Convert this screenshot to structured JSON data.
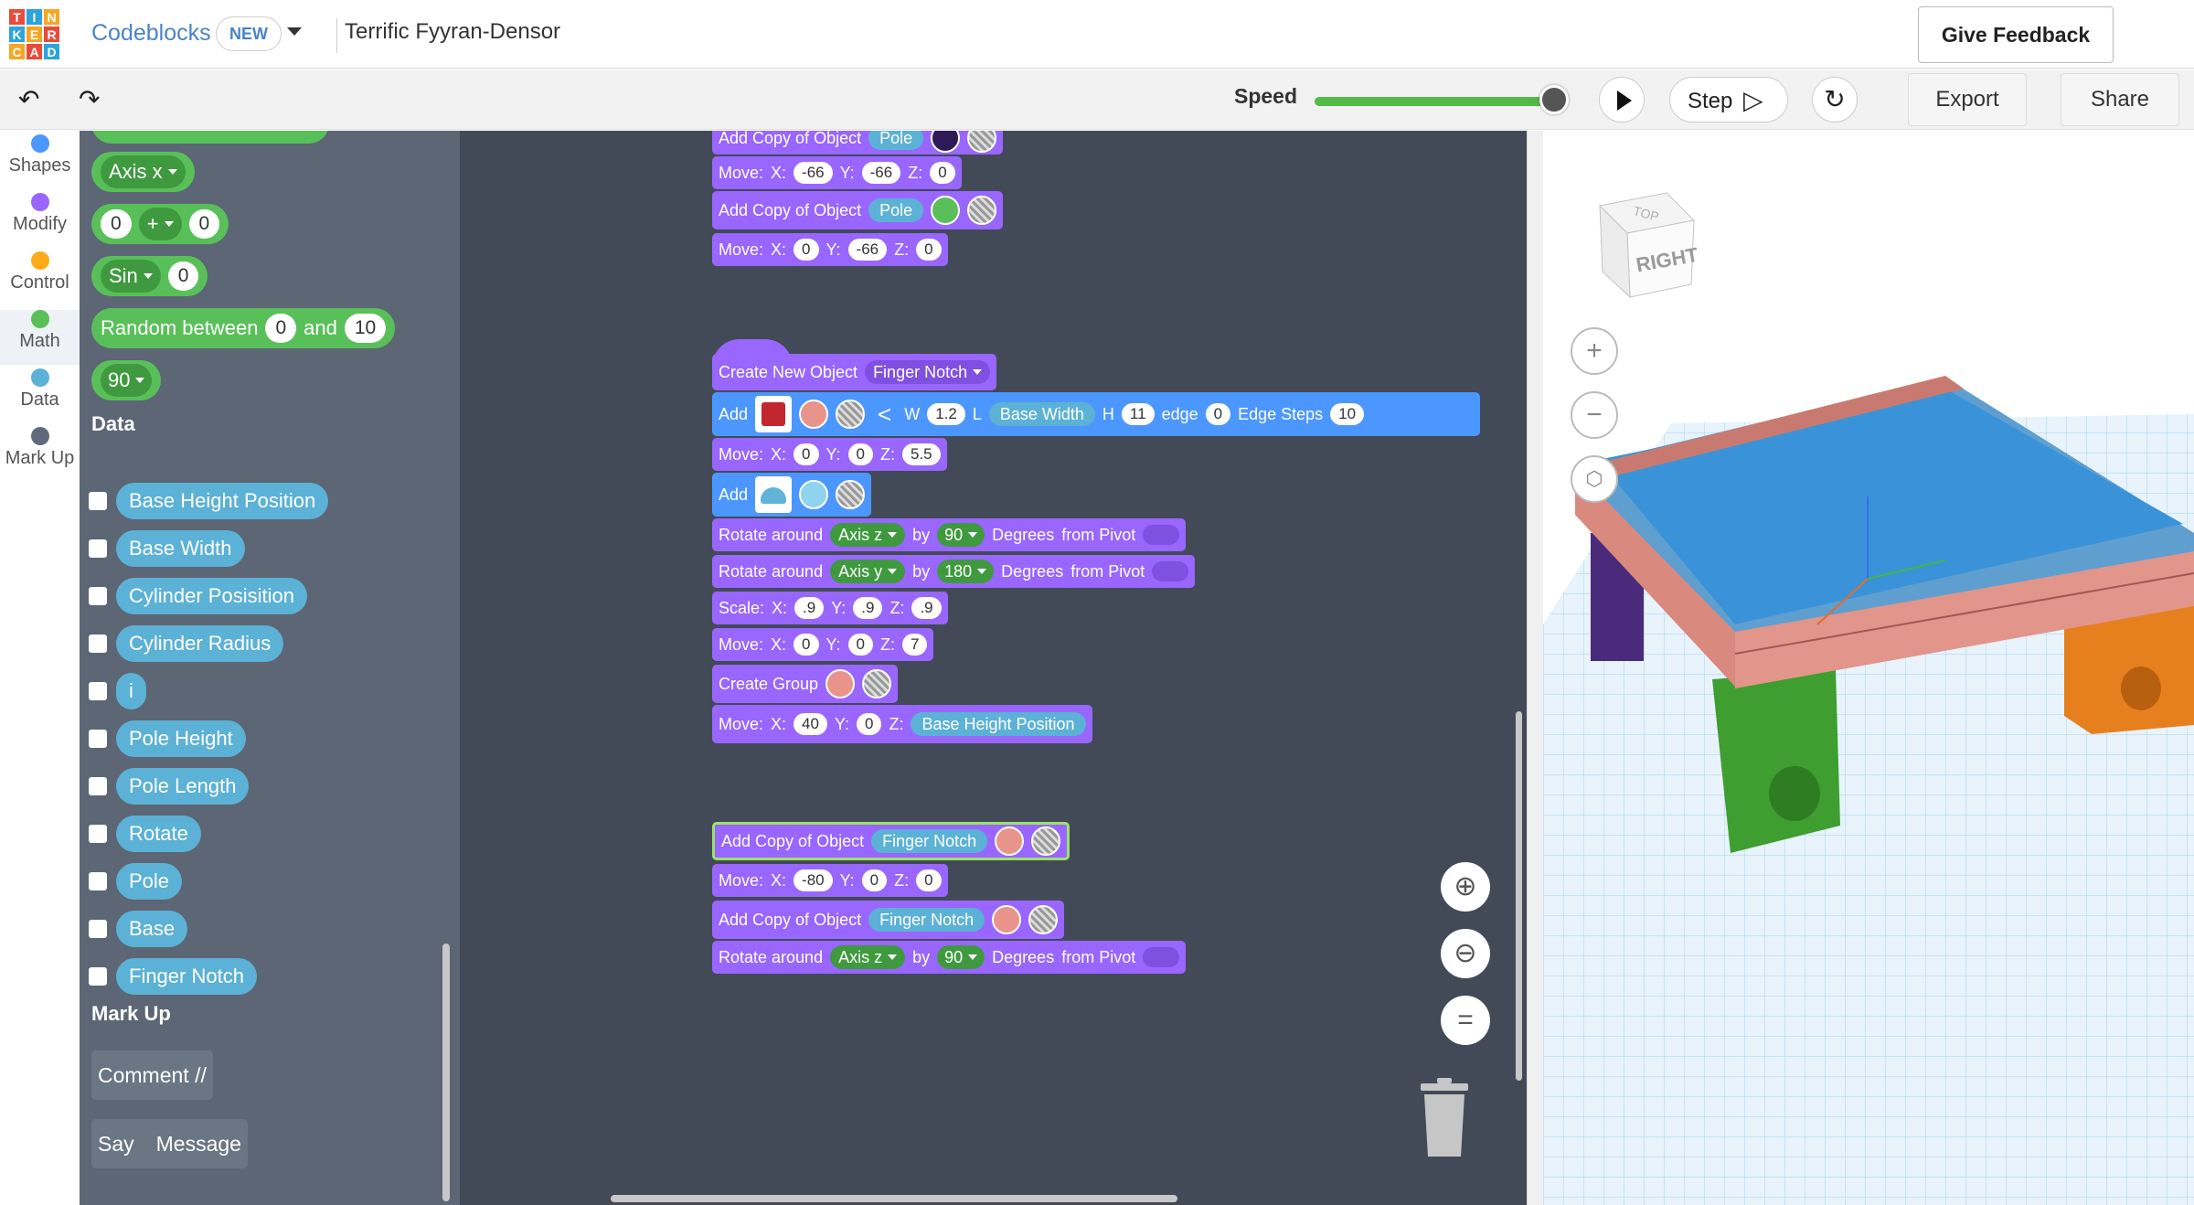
{
  "logo": {
    "letters": [
      "T",
      "I",
      "N",
      "K",
      "E",
      "R",
      "C",
      "A",
      "D"
    ],
    "colors": [
      "#e84b3c",
      "#2ea3dc",
      "#f5a623",
      "#2ea3dc",
      "#f5a623",
      "#e84b3c",
      "#f5a623",
      "#e84b3c",
      "#2ea3dc"
    ]
  },
  "header": {
    "app_name": "Codeblocks",
    "badge": "NEW",
    "design_title": "Terrific Fyyran-Densor",
    "feedback": "Give Feedback"
  },
  "toolbar": {
    "undo_icon": "undo-icon",
    "redo_icon": "redo-icon",
    "speed_label": "Speed",
    "speed_level": 1.0,
    "step_label": "Step",
    "export_label": "Export",
    "share_label": "Share"
  },
  "categories": [
    {
      "label": "Shapes",
      "color": "#4c97ff"
    },
    {
      "label": "Modify",
      "color": "#9966ff"
    },
    {
      "label": "Control",
      "color": "#ffab19"
    },
    {
      "label": "Math",
      "color": "#59c059"
    },
    {
      "label": "Data",
      "color": "#5cb1d6"
    },
    {
      "label": "Mark Up",
      "color": "#5f6a7a"
    }
  ],
  "flyout": {
    "axis": "Axis x",
    "arith": {
      "a": "0",
      "op": "+",
      "b": "0"
    },
    "sin": {
      "fn": "Sin",
      "v": "0"
    },
    "random": {
      "label": "Random between",
      "a": "0",
      "and": "and",
      "b": "10"
    },
    "number": "90",
    "data_heading": "Data",
    "variables": [
      "Base Height Position",
      "Base Width",
      "Cylinder Posisition",
      "Cylinder Radius",
      "i",
      "Pole Height",
      "Pole Length",
      "Rotate",
      "Pole",
      "Base",
      "Finger Notch"
    ],
    "markup_heading": "Mark Up",
    "comment": "Comment //",
    "say": "Say",
    "message": "Message"
  },
  "labels": {
    "add_copy": "Add Copy of Object",
    "move": "Move:",
    "x": "X:",
    "y": "Y:",
    "z": "Z:",
    "create_new": "Create New Object",
    "add": "Add",
    "w": "W",
    "l": "L",
    "h": "H",
    "edge": "edge",
    "edge_steps": "Edge Steps",
    "rotate_around": "Rotate around",
    "by": "by",
    "degrees": "Degrees",
    "from_pivot": "from Pivot",
    "scale": "Scale:",
    "create_group": "Create Group"
  },
  "blocks": {
    "b1": {
      "obj": "Pole",
      "color": "#2e1a57"
    },
    "m1": {
      "x": "-66",
      "y": "-66",
      "z": "0"
    },
    "b2": {
      "obj": "Pole",
      "color": "#59c059"
    },
    "m2": {
      "x": "0",
      "y": "-66",
      "z": "0"
    },
    "cno": {
      "obj": "Finger Notch"
    },
    "addbox": {
      "color": "#e8948a",
      "w": "1.2",
      "l": "Base Width",
      "h": "11",
      "edge": "0",
      "edge_steps": "10"
    },
    "m3": {
      "x": "0",
      "y": "0",
      "z": "5.5"
    },
    "addcyl": {
      "color": "#8fd3ee"
    },
    "rot1": {
      "axis": "Axis z",
      "by": "90"
    },
    "rot2": {
      "axis": "Axis y",
      "by": "180"
    },
    "scale": {
      "x": ".9",
      "y": ".9",
      "z": ".9"
    },
    "m4": {
      "x": "0",
      "y": "0",
      "z": "7"
    },
    "group": {
      "color": "#e8948a"
    },
    "m5": {
      "x": "40",
      "y": "0",
      "z": "Base Height Position"
    },
    "b3": {
      "obj": "Finger Notch",
      "color": "#e8948a"
    },
    "m6": {
      "x": "-80",
      "y": "0",
      "z": "0"
    },
    "b4": {
      "obj": "Finger Notch",
      "color": "#e8948a"
    },
    "rot3": {
      "axis": "Axis z",
      "by": "90"
    }
  },
  "workspace": {
    "zoom_in_icon": "zoom-in-icon",
    "zoom_out_icon": "zoom-out-icon",
    "reset_icon": "equals-icon",
    "trash_icon": "trash-icon"
  },
  "viewport": {
    "cube_face": "RIGHT",
    "cube_top": "TOP"
  }
}
